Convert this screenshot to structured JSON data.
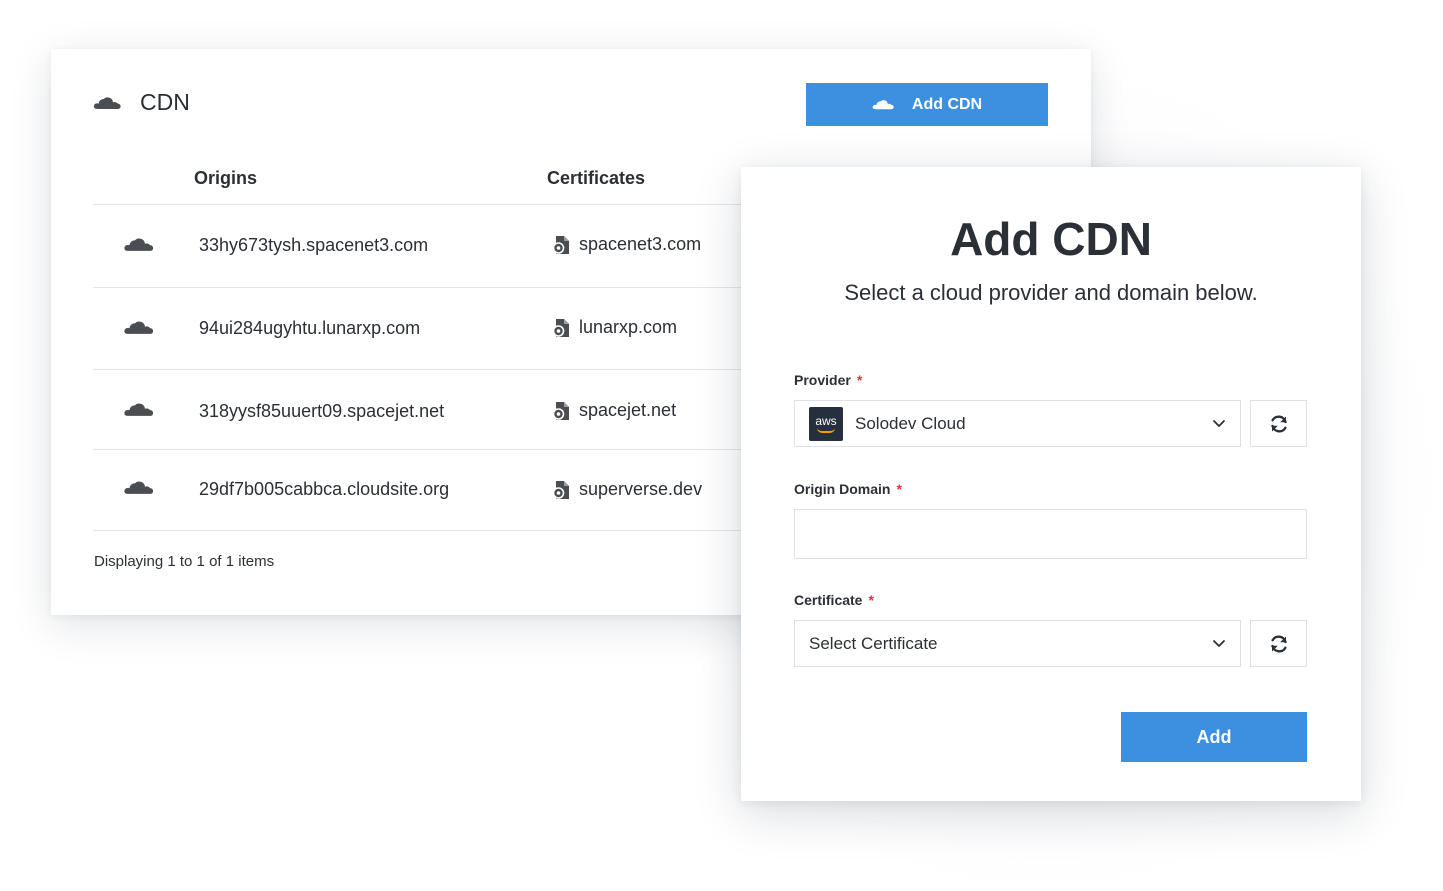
{
  "list": {
    "title": "CDN",
    "add_button_label": "Add CDN",
    "columns": [
      "Origins",
      "Certificates"
    ],
    "rows": [
      {
        "origin": "33hy673tysh.spacenet3.com",
        "certificate": "spacenet3.com"
      },
      {
        "origin": "94ui284ugyhtu.lunarxp.com",
        "certificate": "lunarxp.com"
      },
      {
        "origin": "318yysf85uuert09.spacejet.net",
        "certificate": "spacejet.net"
      },
      {
        "origin": "29df7b005cabbca.cloudsite.org",
        "certificate": "superverse.dev"
      }
    ],
    "footer": "Displaying 1 to 1 of 1 items"
  },
  "modal": {
    "title": "Add CDN",
    "subtitle": "Select a cloud provider and domain below.",
    "provider": {
      "label": "Provider",
      "required_mark": "*",
      "logo_text": "aws",
      "value": "Solodev Cloud"
    },
    "origin_domain": {
      "label": "Origin Domain",
      "required_mark": "*",
      "value": "",
      "placeholder": ""
    },
    "certificate": {
      "label": "Certificate",
      "required_mark": "*",
      "value": "Select Certificate"
    },
    "submit_label": "Add"
  },
  "colors": {
    "accent": "#3d8fe0",
    "text": "#2b2f36",
    "required": "#e0343a",
    "icon": "#4a4d52",
    "border": "#dde0e5"
  },
  "icons": {
    "cloud": "cloud-icon",
    "certificate": "certificate-icon",
    "refresh": "refresh-icon",
    "chevron": "chevron-down-icon"
  }
}
